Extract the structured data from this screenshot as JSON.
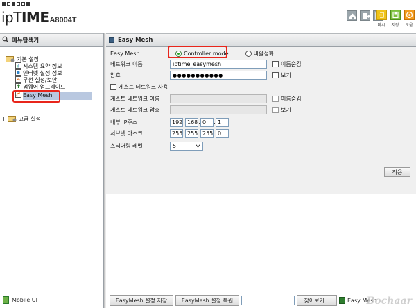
{
  "header": {
    "logo_brand_bold": "ipT",
    "logo_brand_rest": "IME",
    "logo_model": "A8004T",
    "nav_icons": [
      "home-icon",
      "logout-icon",
      "window-icon"
    ],
    "actions": [
      {
        "icon": "help-icon",
        "label": "마시"
      },
      {
        "icon": "save-icon",
        "label": "저장"
      },
      {
        "icon": "guide-icon",
        "label": "도움"
      }
    ]
  },
  "sidebar": {
    "title": "메뉴탐색기",
    "basic_settings": "기본 설정",
    "items": [
      {
        "label": "시스템 요약 정보"
      },
      {
        "label": "인터넷 설정 정보"
      },
      {
        "label": "무선 설정/보안"
      },
      {
        "label": "펌웨어 업그레이드"
      },
      {
        "label": "Easy Mesh"
      }
    ],
    "advanced_settings": "고급 설정",
    "mobile_ui": "Mobile UI"
  },
  "main": {
    "title": "Easy Mesh",
    "fields": {
      "mode_label": "Easy Mesh",
      "mode_options": [
        {
          "label": "Controller mode",
          "selected": true
        },
        {
          "label": "비활성화",
          "selected": false
        }
      ],
      "network_name_label": "네트워크 이름",
      "network_name_value": "iptime_easymesh",
      "hide_name_label": "이름숨김",
      "password_label": "암호",
      "password_value": "●●●●●●●●●●●",
      "show_label": "보기",
      "guest_use_label": "게스트 네트워크 사용",
      "guest_name_label": "게스트 네트워크 이름",
      "guest_hide_label": "이름숨김",
      "guest_password_label": "게스트 네트워크 암호",
      "guest_show_label": "보기",
      "ip_label": "내부 IP주소",
      "ip": [
        "192",
        "168",
        "0",
        "1"
      ],
      "subnet_label": "서브넷 마스크",
      "subnet": [
        "255",
        "255",
        "255",
        "0"
      ],
      "steering_label": "스티어링 레벨",
      "steering_value": "5"
    },
    "apply_label": "적용",
    "bottom": {
      "save_button": "EasyMesh 설정 저장",
      "restore_button": "EasyMesh 설정 복원",
      "browse_button": "찾아보기...",
      "tag_label": "Easy Mesh"
    }
  },
  "watermark": "Bochaar"
}
